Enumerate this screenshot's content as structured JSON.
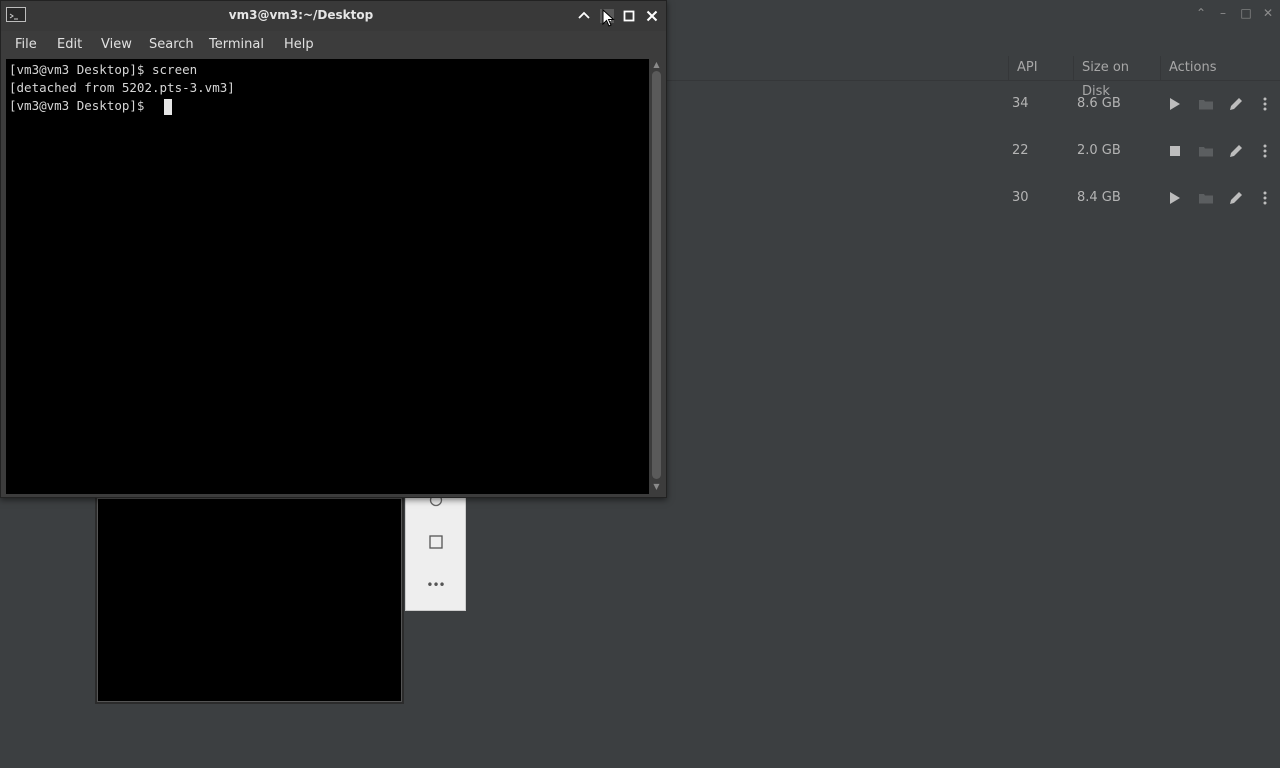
{
  "background_window": {
    "columns": [
      "API",
      "Size on Disk",
      "Actions"
    ],
    "devices": [
      {
        "api": "34",
        "size": "8.6 GB",
        "state": "stopped",
        "run_icon": "play-icon"
      },
      {
        "api": "22",
        "size": "2.0 GB",
        "state": "running",
        "run_icon": "stop-icon"
      },
      {
        "api": "30",
        "size": "8.4 GB",
        "state": "stopped",
        "run_icon": "play-icon"
      }
    ],
    "icons": [
      "folder-icon",
      "pencil-icon",
      "more-vertical-icon"
    ]
  },
  "emulator_toolbar": {
    "icons": [
      "circle-icon",
      "square-icon",
      "more-icon"
    ],
    "more_label": "•••"
  },
  "terminal": {
    "title": "vm3@vm3:~/Desktop",
    "menu": [
      "File",
      "Edit",
      "View",
      "Search",
      "Terminal",
      "Help"
    ],
    "lines": [
      "[vm3@vm3 Desktop]$ screen",
      "[detached from 5202.pts-3.vm3]",
      "[vm3@vm3 Desktop]$ "
    ],
    "colors": {
      "background": "#000000",
      "text": "#d6d6d6",
      "titlebar": "#393939"
    }
  }
}
